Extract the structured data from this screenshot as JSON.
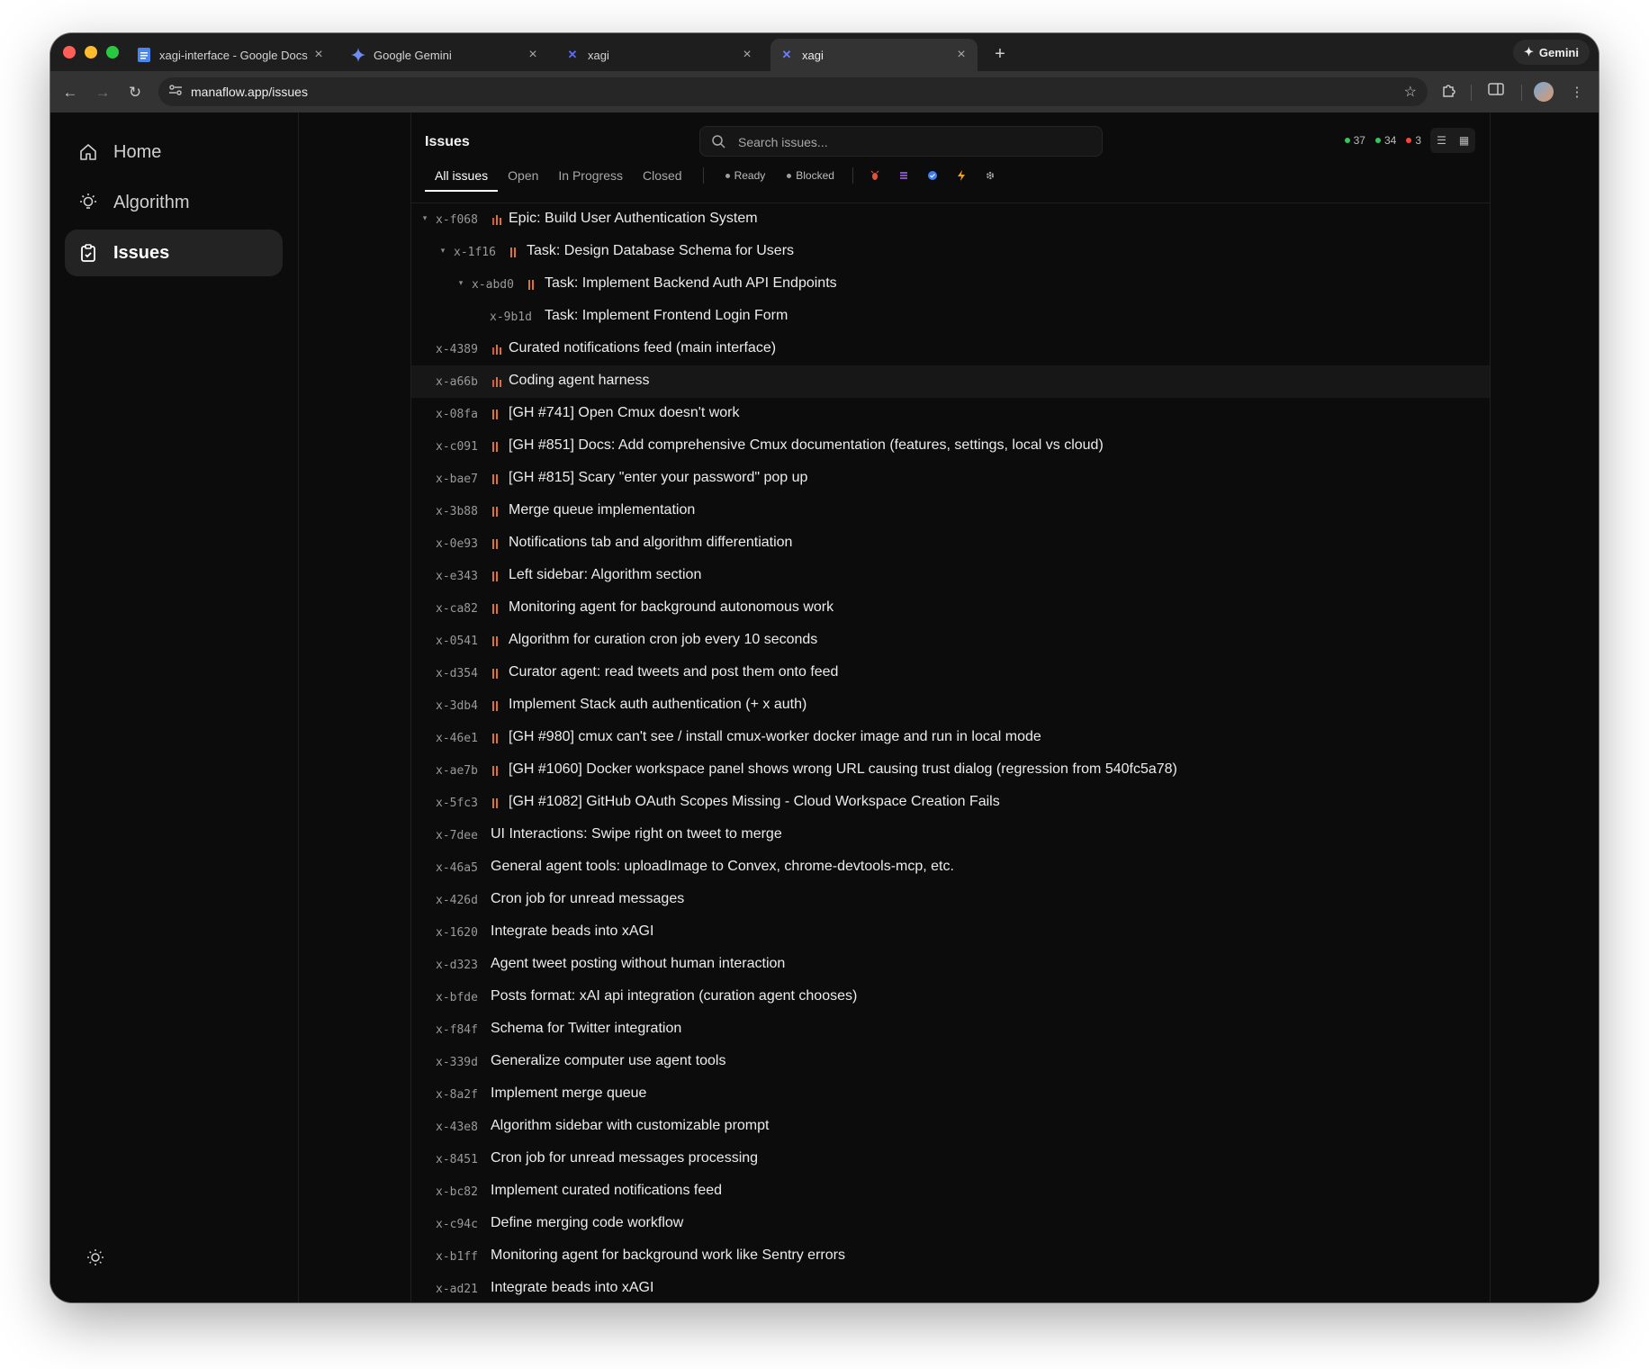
{
  "browser": {
    "tabs": [
      {
        "title": "xagi-interface - Google Docs",
        "icon": "google-docs-icon",
        "active": false
      },
      {
        "title": "Google Gemini",
        "icon": "gemini-icon",
        "active": false
      },
      {
        "title": "xagi",
        "icon": "xagi-icon",
        "active": false
      },
      {
        "title": "xagi",
        "icon": "xagi-icon",
        "active": true
      }
    ],
    "gemini_button": "Gemini",
    "url": "manaflow.app/issues"
  },
  "sidebar": {
    "items": [
      {
        "label": "Home",
        "icon": "home-icon",
        "active": false
      },
      {
        "label": "Algorithm",
        "icon": "lightbulb-icon",
        "active": false
      },
      {
        "label": "Issues",
        "icon": "clipboard-icon",
        "active": true
      }
    ]
  },
  "header": {
    "title": "Issues",
    "search_placeholder": "Search issues...",
    "counts": [
      {
        "value": "37",
        "color": "#34c759"
      },
      {
        "value": "34",
        "color": "#34c759"
      },
      {
        "value": "3",
        "color": "#ff453a"
      }
    ]
  },
  "filters": {
    "tabs": [
      "All issues",
      "Open",
      "In Progress",
      "Closed"
    ],
    "active_tab": "All issues",
    "status": [
      "Ready",
      "Blocked"
    ],
    "type_icons": [
      "bug-icon",
      "feature-icon",
      "task-icon",
      "epic-icon",
      "chore-icon"
    ]
  },
  "colors": {
    "priority": "#e0703a",
    "priority_high": "#e0513a"
  },
  "issues": [
    {
      "id": "x-f068",
      "title": "Epic: Build User Authentication System",
      "depth": 0,
      "expandable": true,
      "priority": 3
    },
    {
      "id": "x-1f16",
      "title": "Task: Design Database Schema for Users",
      "depth": 1,
      "expandable": true,
      "priority": 2
    },
    {
      "id": "x-abd0",
      "title": "Task: Implement Backend Auth API Endpoints",
      "depth": 2,
      "expandable": true,
      "priority": 2
    },
    {
      "id": "x-9b1d",
      "title": "Task: Implement Frontend Login Form",
      "depth": 3,
      "expandable": false,
      "priority": 0
    },
    {
      "id": "x-4389",
      "title": "Curated notifications feed (main interface)",
      "depth": 0,
      "expandable": false,
      "priority": 3
    },
    {
      "id": "x-a66b",
      "title": "Coding agent harness",
      "depth": 0,
      "expandable": false,
      "priority": 3,
      "highlight": true
    },
    {
      "id": "x-08fa",
      "title": "[GH #741] Open Cmux doesn't work",
      "depth": 0,
      "expandable": false,
      "priority": 2
    },
    {
      "id": "x-c091",
      "title": "[GH #851] Docs: Add comprehensive Cmux documentation (features, settings, local vs cloud)",
      "depth": 0,
      "expandable": false,
      "priority": 2
    },
    {
      "id": "x-bae7",
      "title": "[GH #815] Scary \"enter your password\" pop up",
      "depth": 0,
      "expandable": false,
      "priority": 2
    },
    {
      "id": "x-3b88",
      "title": "Merge queue implementation",
      "depth": 0,
      "expandable": false,
      "priority": 2
    },
    {
      "id": "x-0e93",
      "title": "Notifications tab and algorithm differentiation",
      "depth": 0,
      "expandable": false,
      "priority": 2
    },
    {
      "id": "x-e343",
      "title": "Left sidebar: Algorithm section",
      "depth": 0,
      "expandable": false,
      "priority": 2
    },
    {
      "id": "x-ca82",
      "title": "Monitoring agent for background autonomous work",
      "depth": 0,
      "expandable": false,
      "priority": 2
    },
    {
      "id": "x-0541",
      "title": "Algorithm for curation cron job every 10 seconds",
      "depth": 0,
      "expandable": false,
      "priority": 2
    },
    {
      "id": "x-d354",
      "title": "Curator agent: read tweets and post them onto feed",
      "depth": 0,
      "expandable": false,
      "priority": 2
    },
    {
      "id": "x-3db4",
      "title": "Implement Stack auth authentication (+ x auth)",
      "depth": 0,
      "expandable": false,
      "priority": 2
    },
    {
      "id": "x-46e1",
      "title": "[GH #980] cmux can't see / install cmux-worker docker image and run in local mode",
      "depth": 0,
      "expandable": false,
      "priority": 2
    },
    {
      "id": "x-ae7b",
      "title": "[GH #1060] Docker workspace panel shows wrong URL causing trust dialog (regression from 540fc5a78)",
      "depth": 0,
      "expandable": false,
      "priority": 2
    },
    {
      "id": "x-5fc3",
      "title": "[GH #1082] GitHub OAuth Scopes Missing - Cloud Workspace Creation Fails",
      "depth": 0,
      "expandable": false,
      "priority": 2
    },
    {
      "id": "x-7dee",
      "title": "UI Interactions: Swipe right on tweet to merge",
      "depth": 0,
      "expandable": false,
      "priority": 0
    },
    {
      "id": "x-46a5",
      "title": "General agent tools: uploadImage to Convex, chrome-devtools-mcp, etc.",
      "depth": 0,
      "expandable": false,
      "priority": 0
    },
    {
      "id": "x-426d",
      "title": "Cron job for unread messages",
      "depth": 0,
      "expandable": false,
      "priority": 0
    },
    {
      "id": "x-1620",
      "title": "Integrate beads into xAGI",
      "depth": 0,
      "expandable": false,
      "priority": 0
    },
    {
      "id": "x-d323",
      "title": "Agent tweet posting without human interaction",
      "depth": 0,
      "expandable": false,
      "priority": 0
    },
    {
      "id": "x-bfde",
      "title": "Posts format: xAI api integration (curation agent chooses)",
      "depth": 0,
      "expandable": false,
      "priority": 0
    },
    {
      "id": "x-f84f",
      "title": "Schema for Twitter integration",
      "depth": 0,
      "expandable": false,
      "priority": 0
    },
    {
      "id": "x-339d",
      "title": "Generalize computer use agent tools",
      "depth": 0,
      "expandable": false,
      "priority": 0
    },
    {
      "id": "x-8a2f",
      "title": "Implement merge queue",
      "depth": 0,
      "expandable": false,
      "priority": 0
    },
    {
      "id": "x-43e8",
      "title": "Algorithm sidebar with customizable prompt",
      "depth": 0,
      "expandable": false,
      "priority": 0
    },
    {
      "id": "x-8451",
      "title": "Cron job for unread messages processing",
      "depth": 0,
      "expandable": false,
      "priority": 0
    },
    {
      "id": "x-bc82",
      "title": "Implement curated notifications feed",
      "depth": 0,
      "expandable": false,
      "priority": 0
    },
    {
      "id": "x-c94c",
      "title": "Define merging code workflow",
      "depth": 0,
      "expandable": false,
      "priority": 0
    },
    {
      "id": "x-b1ff",
      "title": "Monitoring agent for background work like Sentry errors",
      "depth": 0,
      "expandable": false,
      "priority": 0
    },
    {
      "id": "x-ad21",
      "title": "Integrate beads into xAGI",
      "depth": 0,
      "expandable": false,
      "priority": 0
    }
  ]
}
